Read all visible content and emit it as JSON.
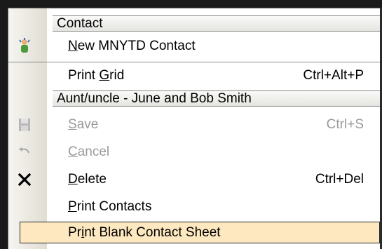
{
  "menu": {
    "section1_header": "Contact",
    "section2_header": "Aunt/uncle - June and Bob Smith",
    "items": [
      {
        "pre": "",
        "ul": "N",
        "post": "ew MNYTD Contact",
        "shortcut": "",
        "icon": "new-contact-icon"
      },
      {
        "pre": "Print ",
        "ul": "G",
        "post": "rid",
        "shortcut": "Ctrl+Alt+P",
        "icon": ""
      },
      {
        "pre": "",
        "ul": "S",
        "post": "ave",
        "shortcut": "Ctrl+S",
        "icon": "save-icon",
        "disabled": true
      },
      {
        "pre": "",
        "ul": "C",
        "post": "ancel",
        "shortcut": "",
        "icon": "undo-icon",
        "disabled": true
      },
      {
        "pre": "",
        "ul": "D",
        "post": "elete",
        "shortcut": "Ctrl+Del",
        "icon": "delete-x-icon"
      },
      {
        "pre": "",
        "ul": "P",
        "post": "rint Contacts",
        "shortcut": "",
        "icon": ""
      },
      {
        "pre": "Pr",
        "ul": "i",
        "post": "nt Blank Contact Sheet",
        "shortcut": "",
        "icon": "",
        "highlighted": true
      }
    ],
    "colors": {
      "highlight": "#fde8c0",
      "disabled_text": "#9a9a9a",
      "gutter": "#e8e6dd"
    }
  }
}
